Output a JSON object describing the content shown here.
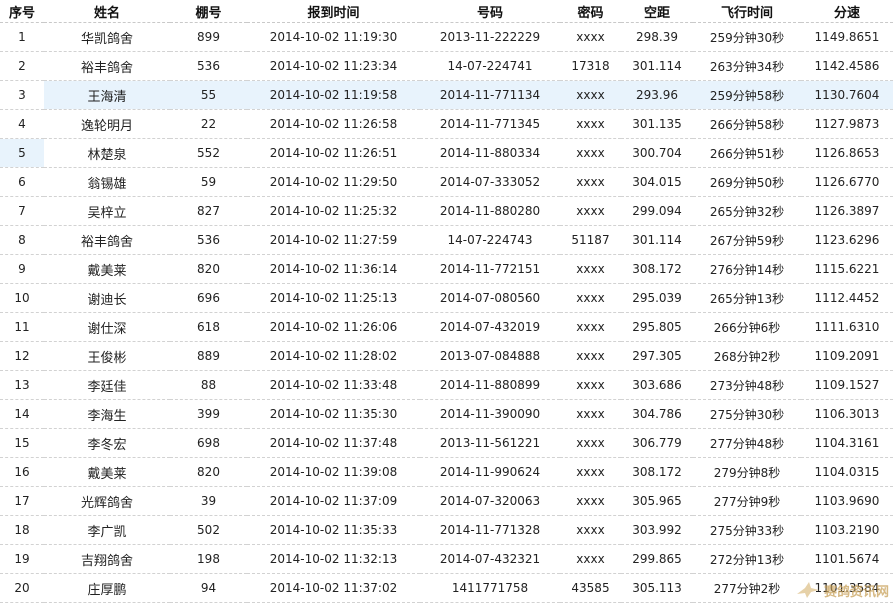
{
  "table": {
    "headers": [
      "序号",
      "姓名",
      "棚号",
      "报到时间",
      "号码",
      "密码",
      "空距",
      "飞行时间",
      "分速"
    ],
    "highlight_row": 3,
    "highlight_seq": 5,
    "rows": [
      [
        "1",
        "华凯鸽舍",
        "899",
        "2014-10-02 11:19:30",
        "2013-11-222229",
        "xxxx",
        "298.39",
        "259分钟30秒",
        "1149.8651"
      ],
      [
        "2",
        "裕丰鸽舍",
        "536",
        "2014-10-02 11:23:34",
        "14-07-224741",
        "17318",
        "301.114",
        "263分钟34秒",
        "1142.4586"
      ],
      [
        "3",
        "王海清",
        "55",
        "2014-10-02 11:19:58",
        "2014-11-771134",
        "xxxx",
        "293.96",
        "259分钟58秒",
        "1130.7604"
      ],
      [
        "4",
        "逸轮明月",
        "22",
        "2014-10-02 11:26:58",
        "2014-11-771345",
        "xxxx",
        "301.135",
        "266分钟58秒",
        "1127.9873"
      ],
      [
        "5",
        "林楚泉",
        "552",
        "2014-10-02 11:26:51",
        "2014-11-880334",
        "xxxx",
        "300.704",
        "266分钟51秒",
        "1126.8653"
      ],
      [
        "6",
        "翁锡雄",
        "59",
        "2014-10-02 11:29:50",
        "2014-07-333052",
        "xxxx",
        "304.015",
        "269分钟50秒",
        "1126.6770"
      ],
      [
        "7",
        "吴梓立",
        "827",
        "2014-10-02 11:25:32",
        "2014-11-880280",
        "xxxx",
        "299.094",
        "265分钟32秒",
        "1126.3897"
      ],
      [
        "8",
        "裕丰鸽舍",
        "536",
        "2014-10-02 11:27:59",
        "14-07-224743",
        "51187",
        "301.114",
        "267分钟59秒",
        "1123.6296"
      ],
      [
        "9",
        "戴美莱",
        "820",
        "2014-10-02 11:36:14",
        "2014-11-772151",
        "xxxx",
        "308.172",
        "276分钟14秒",
        "1115.6221"
      ],
      [
        "10",
        "谢迪长",
        "696",
        "2014-10-02 11:25:13",
        "2014-07-080560",
        "xxxx",
        "295.039",
        "265分钟13秒",
        "1112.4452"
      ],
      [
        "11",
        "谢仕深",
        "618",
        "2014-10-02 11:26:06",
        "2014-07-432019",
        "xxxx",
        "295.805",
        "266分钟6秒",
        "1111.6310"
      ],
      [
        "12",
        "王俊彬",
        "889",
        "2014-10-02 11:28:02",
        "2013-07-084888",
        "xxxx",
        "297.305",
        "268分钟2秒",
        "1109.2091"
      ],
      [
        "13",
        "李廷佳",
        "88",
        "2014-10-02 11:33:48",
        "2014-11-880899",
        "xxxx",
        "303.686",
        "273分钟48秒",
        "1109.1527"
      ],
      [
        "14",
        "李海生",
        "399",
        "2014-10-02 11:35:30",
        "2014-11-390090",
        "xxxx",
        "304.786",
        "275分钟30秒",
        "1106.3013"
      ],
      [
        "15",
        "李冬宏",
        "698",
        "2014-10-02 11:37:48",
        "2013-11-561221",
        "xxxx",
        "306.779",
        "277分钟48秒",
        "1104.3161"
      ],
      [
        "16",
        "戴美莱",
        "820",
        "2014-10-02 11:39:08",
        "2014-11-990624",
        "xxxx",
        "308.172",
        "279分钟8秒",
        "1104.0315"
      ],
      [
        "17",
        "光辉鸽舍",
        "39",
        "2014-10-02 11:37:09",
        "2014-07-320063",
        "xxxx",
        "305.965",
        "277分钟9秒",
        "1103.9690"
      ],
      [
        "18",
        "李广凯",
        "502",
        "2014-10-02 11:35:33",
        "2014-11-771328",
        "xxxx",
        "303.992",
        "275分钟33秒",
        "1103.2190"
      ],
      [
        "19",
        "吉翔鸽舍",
        "198",
        "2014-10-02 11:32:13",
        "2014-07-432321",
        "xxxx",
        "299.865",
        "272分钟13秒",
        "1101.5674"
      ],
      [
        "20",
        "庄厚鹏",
        "94",
        "2014-10-02 11:37:02",
        "1411771758",
        "43585",
        "305.113",
        "277分钟2秒",
        "1101.3584"
      ]
    ]
  },
  "watermark": {
    "text": "赛鸽资讯网",
    "icon": "pigeon-logo-icon",
    "color": "#c9a25b"
  }
}
